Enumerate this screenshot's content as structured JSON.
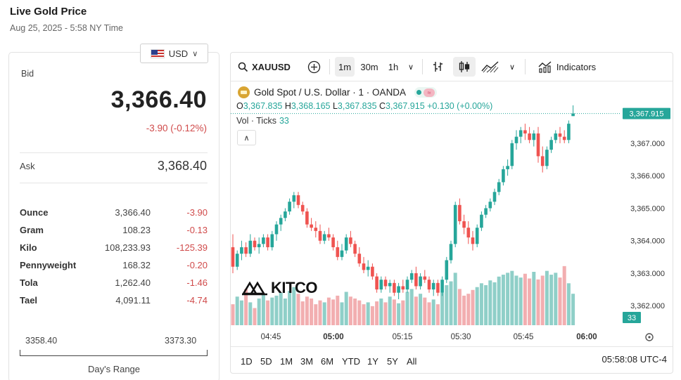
{
  "header": {
    "title": "Live Gold Price",
    "timestamp": "Aug 25, 2025 - 5:58 NY Time"
  },
  "currency": {
    "selected": "USD"
  },
  "price": {
    "bid_label": "Bid",
    "bid": "3,366.40",
    "change": "-3.90 (-0.12%)",
    "ask_label": "Ask",
    "ask": "3,368.40"
  },
  "units": [
    {
      "name": "Ounce",
      "price": "3,366.40",
      "change": "-3.90"
    },
    {
      "name": "Gram",
      "price": "108.23",
      "change": "-0.13"
    },
    {
      "name": "Kilo",
      "price": "108,233.93",
      "change": "-125.39"
    },
    {
      "name": "Pennyweight",
      "price": "168.32",
      "change": "-0.20"
    },
    {
      "name": "Tola",
      "price": "1,262.40",
      "change": "-1.46"
    },
    {
      "name": "Tael",
      "price": "4,091.11",
      "change": "-4.74"
    }
  ],
  "days_range": {
    "low": "3358.40",
    "high": "3373.30",
    "label": "Day's Range"
  },
  "toolbar": {
    "symbol": "XAUUSD",
    "intervals": [
      "1m",
      "30m",
      "1h"
    ],
    "active_interval": "1m",
    "indicators_label": "Indicators",
    "icons": [
      "search-icon",
      "add-icon",
      "chevron-down-icon",
      "bar-chart-icon",
      "candlestick-icon",
      "area-chart-icon",
      "indicators-icon"
    ]
  },
  "legend": {
    "title": "Gold Spot / U.S. Dollar · 1 · OANDA",
    "o": "3,367.835",
    "h": "3,368.165",
    "l": "3,367.835",
    "c": "3,367.915",
    "change": "+0.130 (+0.00%)",
    "vol_label": "Vol · Ticks",
    "vol_value": "33"
  },
  "colors": {
    "up": "#26a69a",
    "down": "#ef5350",
    "vol_up": "#8fcfc8",
    "vol_down": "#f2aeb0",
    "accent_red": "#d04a4a"
  },
  "bottom_bar": {
    "ranges": [
      "1D",
      "5D",
      "1M",
      "3M",
      "6M",
      "YTD",
      "1Y",
      "5Y",
      "All"
    ],
    "clock": "05:58:08 UTC-4"
  },
  "watermark": {
    "text": "KITCO"
  },
  "chart_data": {
    "type": "candlestick",
    "x_ticks": [
      "04:45",
      "05:00",
      "05:15",
      "05:30",
      "05:45",
      "06:00"
    ],
    "y_ticks": [
      "3,362.000",
      "3,363.000",
      "3,364.000",
      "3,365.000",
      "3,366.000",
      "3,367.000"
    ],
    "ylim": [
      3361.4,
      3368.9
    ],
    "last_price_label": "3,367.915",
    "last_volume_label": "33",
    "candles": [
      [
        3363.8,
        3364.2,
        3363.0,
        3363.2
      ],
      [
        3363.2,
        3363.7,
        3363.1,
        3363.6
      ],
      [
        3363.6,
        3364.0,
        3363.4,
        3363.8
      ],
      [
        3363.8,
        3363.95,
        3363.5,
        3363.6
      ],
      [
        3363.6,
        3364.2,
        3363.5,
        3364.0
      ],
      [
        3364.0,
        3364.1,
        3363.7,
        3363.8
      ],
      [
        3363.8,
        3364.1,
        3363.6,
        3363.9
      ],
      [
        3363.9,
        3364.2,
        3363.8,
        3364.1
      ],
      [
        3364.1,
        3364.2,
        3363.7,
        3363.8
      ],
      [
        3363.8,
        3364.3,
        3363.7,
        3364.2
      ],
      [
        3364.2,
        3364.6,
        3364.0,
        3364.5
      ],
      [
        3364.5,
        3364.8,
        3364.3,
        3364.7
      ],
      [
        3364.7,
        3365.0,
        3364.6,
        3364.9
      ],
      [
        3364.9,
        3365.3,
        3364.8,
        3365.2
      ],
      [
        3365.2,
        3365.5,
        3365.0,
        3365.4
      ],
      [
        3365.4,
        3365.5,
        3365.0,
        3365.1
      ],
      [
        3365.1,
        3365.2,
        3364.8,
        3364.9
      ],
      [
        3364.9,
        3365.0,
        3364.4,
        3364.5
      ],
      [
        3364.5,
        3364.7,
        3364.3,
        3364.4
      ],
      [
        3364.4,
        3364.6,
        3364.1,
        3364.3
      ],
      [
        3364.3,
        3364.5,
        3363.9,
        3364.0
      ],
      [
        3364.0,
        3364.3,
        3363.9,
        3364.2
      ],
      [
        3364.2,
        3364.4,
        3364.0,
        3364.1
      ],
      [
        3364.1,
        3364.2,
        3363.7,
        3363.8
      ],
      [
        3363.8,
        3364.0,
        3363.4,
        3363.5
      ],
      [
        3363.5,
        3363.9,
        3363.4,
        3363.7
      ],
      [
        3363.7,
        3364.2,
        3363.6,
        3364.1
      ],
      [
        3364.1,
        3364.3,
        3363.8,
        3363.9
      ],
      [
        3363.9,
        3364.0,
        3363.5,
        3363.6
      ],
      [
        3363.6,
        3363.8,
        3363.2,
        3363.3
      ],
      [
        3363.3,
        3363.5,
        3363.0,
        3363.1
      ],
      [
        3363.1,
        3363.4,
        3362.9,
        3363.2
      ],
      [
        3363.2,
        3363.3,
        3362.8,
        3362.9
      ],
      [
        3362.9,
        3363.0,
        3362.4,
        3362.5
      ],
      [
        3362.5,
        3362.9,
        3362.4,
        3362.8
      ],
      [
        3362.8,
        3362.9,
        3362.5,
        3362.6
      ],
      [
        3362.6,
        3362.8,
        3362.4,
        3362.7
      ],
      [
        3362.7,
        3362.8,
        3362.3,
        3362.4
      ],
      [
        3362.4,
        3362.7,
        3362.2,
        3362.6
      ],
      [
        3362.6,
        3362.8,
        3362.4,
        3362.5
      ],
      [
        3362.5,
        3362.9,
        3362.4,
        3362.8
      ],
      [
        3362.8,
        3363.1,
        3362.7,
        3363.0
      ],
      [
        3363.0,
        3363.2,
        3362.5,
        3362.6
      ],
      [
        3362.6,
        3363.0,
        3362.5,
        3362.9
      ],
      [
        3362.9,
        3363.1,
        3362.7,
        3362.8
      ],
      [
        3362.8,
        3362.9,
        3362.4,
        3362.5
      ],
      [
        3362.5,
        3362.8,
        3362.3,
        3362.7
      ],
      [
        3362.7,
        3362.8,
        3362.3,
        3362.4
      ],
      [
        3362.4,
        3362.9,
        3362.3,
        3362.8
      ],
      [
        3362.8,
        3363.5,
        3362.7,
        3363.4
      ],
      [
        3363.4,
        3364.0,
        3363.3,
        3363.9
      ],
      [
        3363.9,
        3365.2,
        3363.8,
        3365.1
      ],
      [
        3365.1,
        3365.3,
        3364.5,
        3364.6
      ],
      [
        3364.6,
        3364.8,
        3364.2,
        3364.4
      ],
      [
        3364.4,
        3364.6,
        3363.9,
        3364.1
      ],
      [
        3364.1,
        3364.3,
        3363.7,
        3363.9
      ],
      [
        3363.9,
        3364.5,
        3363.8,
        3364.4
      ],
      [
        3364.4,
        3364.9,
        3364.3,
        3364.8
      ],
      [
        3364.8,
        3365.1,
        3364.7,
        3365.0
      ],
      [
        3365.0,
        3365.3,
        3364.9,
        3365.2
      ],
      [
        3365.2,
        3365.6,
        3365.1,
        3365.5
      ],
      [
        3365.5,
        3365.9,
        3365.4,
        3365.8
      ],
      [
        3365.8,
        3366.3,
        3365.7,
        3366.2
      ],
      [
        3366.2,
        3366.5,
        3366.0,
        3366.3
      ],
      [
        3366.3,
        3367.1,
        3366.2,
        3367.0
      ],
      [
        3367.0,
        3367.4,
        3366.8,
        3367.2
      ],
      [
        3367.2,
        3367.5,
        3367.0,
        3367.4
      ],
      [
        3367.4,
        3367.6,
        3367.1,
        3367.3
      ],
      [
        3367.3,
        3367.5,
        3367.0,
        3367.1
      ],
      [
        3367.1,
        3367.4,
        3366.9,
        3367.3
      ],
      [
        3367.3,
        3367.5,
        3366.4,
        3366.6
      ],
      [
        3366.6,
        3366.9,
        3366.1,
        3366.3
      ],
      [
        3366.3,
        3366.9,
        3366.2,
        3366.8
      ],
      [
        3366.8,
        3367.2,
        3366.7,
        3367.1
      ],
      [
        3367.1,
        3367.4,
        3367.0,
        3367.3
      ],
      [
        3367.3,
        3367.5,
        3367.0,
        3367.2
      ],
      [
        3367.2,
        3367.4,
        3367.0,
        3367.1
      ],
      [
        3367.1,
        3367.7,
        3367.0,
        3367.6
      ],
      [
        3367.835,
        3368.165,
        3367.835,
        3367.915
      ]
    ],
    "volumes": [
      22,
      30,
      26,
      38,
      24,
      18,
      28,
      32,
      26,
      29,
      31,
      34,
      28,
      36,
      40,
      33,
      25,
      30,
      28,
      22,
      26,
      24,
      29,
      27,
      31,
      24,
      35,
      30,
      28,
      26,
      22,
      24,
      20,
      25,
      28,
      24,
      30,
      27,
      23,
      26,
      35,
      38,
      30,
      33,
      29,
      24,
      27,
      22,
      34,
      42,
      46,
      55,
      38,
      31,
      33,
      37,
      40,
      44,
      42,
      47,
      45,
      51,
      53,
      55,
      57,
      52,
      50,
      54,
      49,
      56,
      48,
      52,
      57,
      53,
      55,
      50,
      62,
      44,
      33
    ]
  }
}
